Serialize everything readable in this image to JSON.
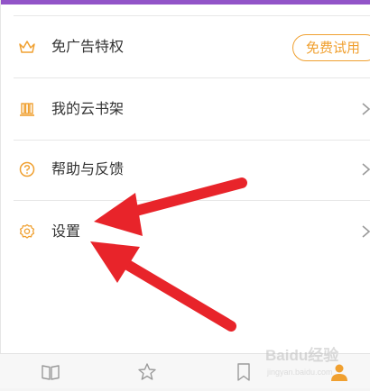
{
  "menu": {
    "ad_free": {
      "label": "免广告特权",
      "button": "免费试用",
      "icon": "crown-icon"
    },
    "bookshelf": {
      "label": "我的云书架",
      "icon": "bookshelf-icon"
    },
    "help": {
      "label": "帮助与反馈",
      "icon": "help-circle-icon"
    },
    "settings": {
      "label": "设置",
      "icon": "gear-icon"
    }
  },
  "tabbar": {
    "tabs": [
      {
        "icon": "book-icon",
        "active": false
      },
      {
        "icon": "star-icon",
        "active": false
      },
      {
        "icon": "bookmark-icon",
        "active": false
      },
      {
        "icon": "person-icon",
        "active": true
      }
    ]
  },
  "watermark": {
    "text": "Baidu经验",
    "subtext": "jingyan.baidu.com"
  },
  "colors": {
    "accent": "#f0a030",
    "top_strip": "#9254c8",
    "arrow": "#e8242a",
    "label": "#333333",
    "chevron": "#9a9a9a"
  }
}
